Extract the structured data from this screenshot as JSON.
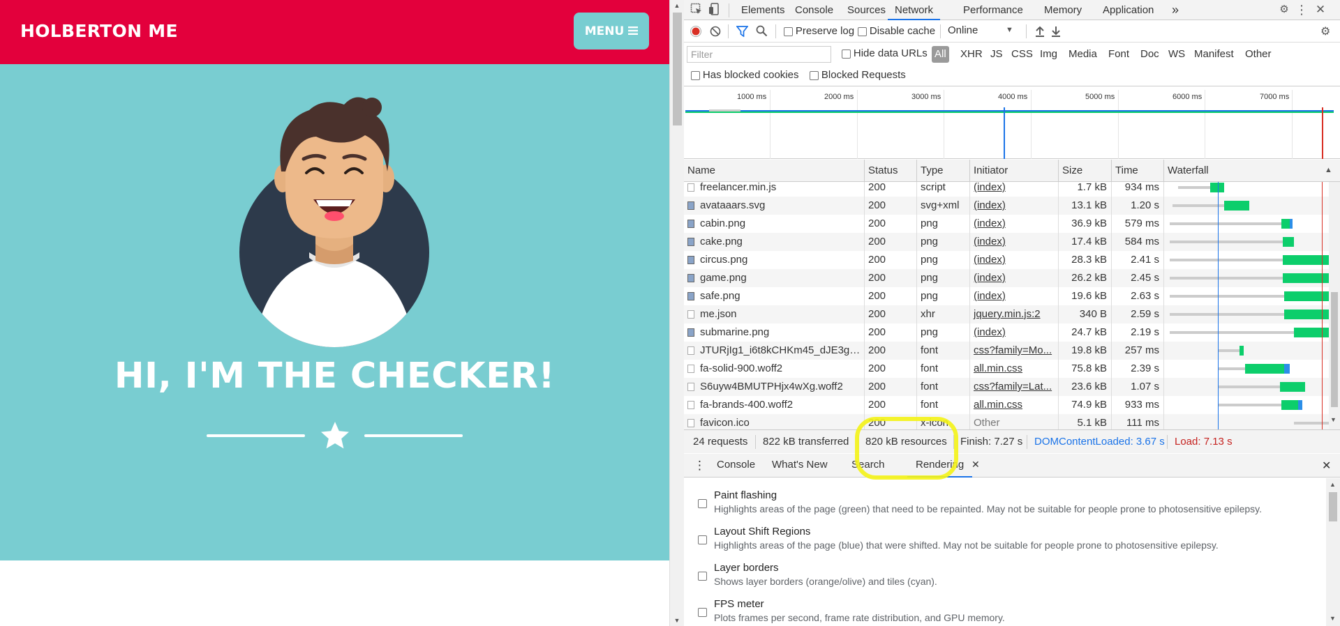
{
  "page": {
    "brand": "HOLBERTON ME",
    "menu_label": "MENU",
    "hero_title": "HI, I'M THE CHECKER!",
    "colors": {
      "navbar": "#e3003c",
      "hero": "#79cdd1",
      "avatar_bg": "#2d3a4b"
    }
  },
  "devtools": {
    "tabs": [
      "Elements",
      "Console",
      "Sources",
      "Network",
      "Performance",
      "Memory",
      "Application"
    ],
    "active_tab": "Network",
    "more_tabs": "»",
    "toolbar": {
      "preserve_log": "Preserve log",
      "disable_cache": "Disable cache",
      "throttle": "Online"
    },
    "filter": {
      "placeholder": "Filter",
      "hide_data_urls": "Hide data URLs",
      "types": [
        "All",
        "XHR",
        "JS",
        "CSS",
        "Img",
        "Media",
        "Font",
        "Doc",
        "WS",
        "Manifest",
        "Other"
      ],
      "has_blocked_cookies": "Has blocked cookies",
      "blocked_requests": "Blocked Requests"
    },
    "overview_ticks": [
      "1000 ms",
      "2000 ms",
      "3000 ms",
      "4000 ms",
      "5000 ms",
      "6000 ms",
      "7000 ms"
    ],
    "columns": [
      "Name",
      "Status",
      "Type",
      "Initiator",
      "Size",
      "Time",
      "Waterfall"
    ],
    "rows": [
      {
        "name": "freelancer.min.js",
        "status": "200",
        "type": "script",
        "initiator": "(index)",
        "size": "1.7 kB",
        "time": "934 ms",
        "icon": "file-icon"
      },
      {
        "name": "avataaars.svg",
        "status": "200",
        "type": "svg+xml",
        "initiator": "(index)",
        "size": "13.1 kB",
        "time": "1.20 s",
        "icon": "image-icon"
      },
      {
        "name": "cabin.png",
        "status": "200",
        "type": "png",
        "initiator": "(index)",
        "size": "36.9 kB",
        "time": "579 ms",
        "icon": "image-icon"
      },
      {
        "name": "cake.png",
        "status": "200",
        "type": "png",
        "initiator": "(index)",
        "size": "17.4 kB",
        "time": "584 ms",
        "icon": "image-icon"
      },
      {
        "name": "circus.png",
        "status": "200",
        "type": "png",
        "initiator": "(index)",
        "size": "28.3 kB",
        "time": "2.41 s",
        "icon": "image-icon"
      },
      {
        "name": "game.png",
        "status": "200",
        "type": "png",
        "initiator": "(index)",
        "size": "26.2 kB",
        "time": "2.45 s",
        "icon": "image-icon"
      },
      {
        "name": "safe.png",
        "status": "200",
        "type": "png",
        "initiator": "(index)",
        "size": "19.6 kB",
        "time": "2.63 s",
        "icon": "image-icon"
      },
      {
        "name": "me.json",
        "status": "200",
        "type": "xhr",
        "initiator": "jquery.min.js:2",
        "size": "340 B",
        "time": "2.59 s",
        "icon": "file-icon"
      },
      {
        "name": "submarine.png",
        "status": "200",
        "type": "png",
        "initiator": "(index)",
        "size": "24.7 kB",
        "time": "2.19 s",
        "icon": "image-icon"
      },
      {
        "name": "JTURjIg1_i6t8kCHKm45_dJE3gn...",
        "status": "200",
        "type": "font",
        "initiator": "css?family=Mo...",
        "size": "19.8 kB",
        "time": "257 ms",
        "icon": "file-icon"
      },
      {
        "name": "fa-solid-900.woff2",
        "status": "200",
        "type": "font",
        "initiator": "all.min.css",
        "size": "75.8 kB",
        "time": "2.39 s",
        "icon": "file-icon"
      },
      {
        "name": "S6uyw4BMUTPHjx4wXg.woff2",
        "status": "200",
        "type": "font",
        "initiator": "css?family=Lat...",
        "size": "23.6 kB",
        "time": "1.07 s",
        "icon": "file-icon"
      },
      {
        "name": "fa-brands-400.woff2",
        "status": "200",
        "type": "font",
        "initiator": "all.min.css",
        "size": "74.9 kB",
        "time": "933 ms",
        "icon": "file-icon"
      },
      {
        "name": "favicon.ico",
        "status": "200",
        "type": "x-icon",
        "initiator": "Other",
        "size": "5.1 kB",
        "time": "111 ms",
        "icon": "file-icon"
      }
    ],
    "summary": {
      "requests": "24 requests",
      "transferred": "822 kB transferred",
      "resources": "820 kB resources",
      "finish": "Finish: 7.27 s",
      "dcl": "DOMContentLoaded: 3.67 s",
      "load": "Load: 7.13 s"
    },
    "drawer_tabs": [
      "Console",
      "What's New",
      "Search",
      "Rendering"
    ],
    "active_drawer_tab": "Rendering",
    "rendering_options": [
      {
        "title": "Paint flashing",
        "desc": "Highlights areas of the page (green) that need to be repainted. May not be suitable for people prone to photosensitive epilepsy."
      },
      {
        "title": "Layout Shift Regions",
        "desc": "Highlights areas of the page (blue) that were shifted. May not be suitable for people prone to photosensitive epilepsy."
      },
      {
        "title": "Layer borders",
        "desc": "Shows layer borders (orange/olive) and tiles (cyan)."
      },
      {
        "title": "FPS meter",
        "desc": "Plots frames per second, frame rate distribution, and GPU memory."
      }
    ]
  }
}
